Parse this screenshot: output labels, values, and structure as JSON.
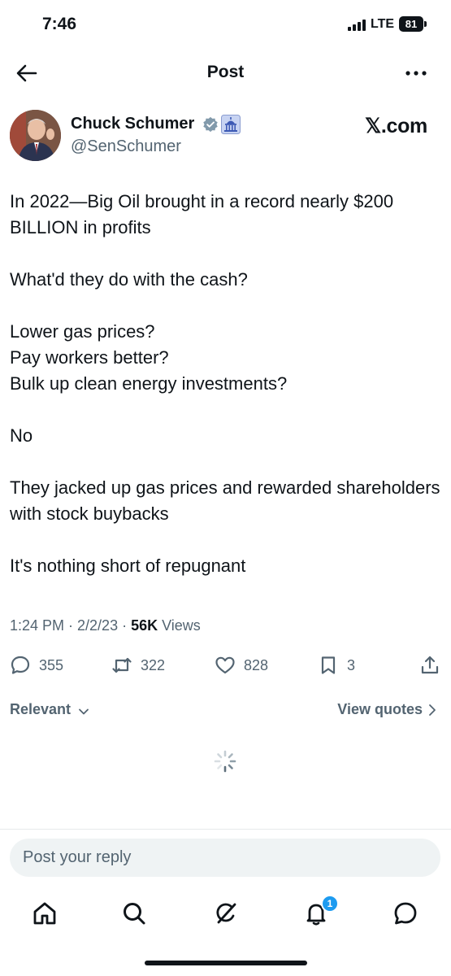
{
  "status_bar": {
    "time": "7:46",
    "network": "LTE",
    "battery": "81"
  },
  "header": {
    "title": "Post",
    "back_icon": "arrow-left-icon",
    "more_icon": "more-horizontal-icon"
  },
  "author": {
    "name": "Chuck Schumer",
    "handle": "@SenSchumer",
    "verified_color": "#829aab",
    "badge_icon": "government-building-icon"
  },
  "watermark": "𝕏.com",
  "post": {
    "paragraphs": [
      "In 2022—Big Oil brought in a record nearly $200 BILLION in profits",
      "What'd they do with the cash?",
      "Lower gas prices?\nPay workers better?\nBulk up clean energy investments?",
      "No",
      "They jacked up gas prices and rewarded shareholders with stock buybacks",
      "It's nothing short of repugnant"
    ],
    "timestamp": "1:24 PM · 2/2/23 · ",
    "views_count": "56K",
    "views_label": " Views"
  },
  "actions": {
    "replies": "355",
    "reposts": "322",
    "likes": "828",
    "bookmarks": "3"
  },
  "replies_section": {
    "sort_label": "Relevant",
    "quotes_label": "View quotes"
  },
  "composer": {
    "placeholder": "Post your reply"
  },
  "tab_bar": {
    "items": [
      "home-icon",
      "search-icon",
      "grok-icon",
      "notifications-icon",
      "messages-icon"
    ],
    "notification_count": "1"
  },
  "colors": {
    "text": "#0f1419",
    "secondary": "#536471",
    "accent": "#1d9bf0"
  }
}
